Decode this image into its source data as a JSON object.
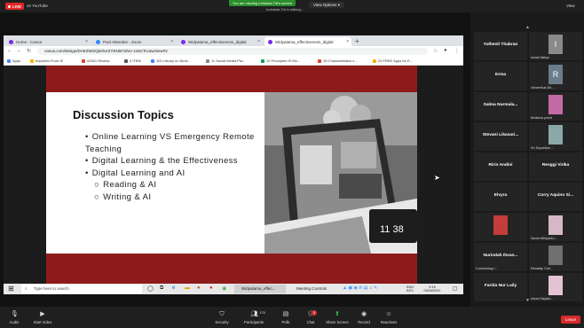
{
  "zoom": {
    "live_label": "LIVE",
    "on_youtube": "on YouTube",
    "viewing_banner": "You are viewing Indriasta Tirt's screen",
    "view_options": "View Options",
    "talking": "Indriasta Tirt is talking...",
    "view_label": "View"
  },
  "browser": {
    "tabs": [
      {
        "label": "Home - Canva",
        "color": "#7d2ae8"
      },
      {
        "label": "Post Attendee - Zoom",
        "color": "#2d8cff"
      },
      {
        "label": "Widyatama_effectiveness_digital",
        "color": "#7d2ae8"
      },
      {
        "label": "Widyatama_effectiveness_digital",
        "color": "#7d2ae8"
      }
    ],
    "url": "canva.com/design/DAEZWOQ63/UrZYEN0I7ahnr-1s5CTcv4w/view#2",
    "bookmarks": [
      "Apps",
      "Imported From IE",
      "#2501 Review",
      "3 ITEM",
      "100 Library nu Simil...",
      "11 Social Media Pla...",
      "12 Principles Of Mo...",
      "15 Characteristics o...",
      "20 FREE Apps for E..."
    ]
  },
  "slide": {
    "title": "Discussion Topics",
    "items": [
      {
        "bullet": "•",
        "text": "Online Learning VS Emergency Remote Teaching",
        "level": 1
      },
      {
        "bullet": "•",
        "text": "Digital Learning & the Effectiveness",
        "level": 1
      },
      {
        "bullet": "•",
        "text": "Digital Learning and AI",
        "level": 1
      },
      {
        "bullet": "○",
        "text": "Reading & AI",
        "level": 2
      },
      {
        "bullet": "○",
        "text": "Writing & AI",
        "level": 2
      }
    ],
    "clock_text": "11 38",
    "colors": {
      "band": "#8e1b1b",
      "title": "#111111"
    }
  },
  "taskbar": {
    "search_placeholder": "Type here to search",
    "app1": "Widyatama_effec...",
    "app2": "Meeting Controls",
    "lang": "ENG",
    "region": "INTL",
    "time": "9:16",
    "date": "09/04/2021"
  },
  "participants": [
    {
      "name": "Yulhenli Thabran",
      "sub": "",
      "style": "name"
    },
    {
      "name": "",
      "sub": "ismail fathyu",
      "style": "video",
      "avatar": "I",
      "color": "#8a8a8a"
    },
    {
      "name": "Erma",
      "sub": "",
      "style": "name"
    },
    {
      "name": "",
      "sub": "Vinsentius Dh...",
      "style": "video",
      "avatar": "R",
      "color": "#6b7c8a"
    },
    {
      "name": "Salma Nurmala...",
      "sub": "",
      "style": "name"
    },
    {
      "name": "",
      "sub": "ferdiana yusuf",
      "style": "video",
      "avatar": "",
      "color": "#c46aa6"
    },
    {
      "name": "Stevani Likasari...",
      "sub": "",
      "style": "name"
    },
    {
      "name": "",
      "sub": "Sri Supartica ...",
      "style": "video",
      "avatar": "",
      "color": "#8aa8a8"
    },
    {
      "name": "Ririn Andini",
      "sub": "",
      "style": "name"
    },
    {
      "name": "Renggi Virika",
      "sub": "",
      "style": "name"
    },
    {
      "name": "Elvyra",
      "sub": "",
      "style": "name"
    },
    {
      "name": "Corry Aquino Si...",
      "sub": "",
      "style": "name"
    },
    {
      "name": "",
      "sub": "",
      "style": "video",
      "avatar": "",
      "color": "#c43c3c"
    },
    {
      "name": "",
      "sub": "Sania Wiriyantu...",
      "style": "video",
      "avatar": "",
      "color": "#d7b7c7"
    },
    {
      "name": "Nurindah Ihsan...",
      "sub": "Connecting t...",
      "style": "name"
    },
    {
      "name": "",
      "sub": "Renaldy Chri...",
      "style": "video",
      "avatar": "",
      "color": "#6f6f6f"
    },
    {
      "name": "Farida Nur Laily",
      "sub": "",
      "style": "name"
    },
    {
      "name": "",
      "sub": "Aziza Hayatu...",
      "style": "video",
      "avatar": "",
      "color": "#e3c3d3"
    }
  ],
  "controls": {
    "audio": "Audio",
    "start_video": "Start Video",
    "security": "Security",
    "participants": "Participants",
    "participants_count": "175",
    "polls": "Polls",
    "chat": "Chat",
    "chat_badge": "3",
    "share_screen": "Share Screen",
    "record": "Record",
    "reactions": "Reactions",
    "leave": "Leave"
  }
}
